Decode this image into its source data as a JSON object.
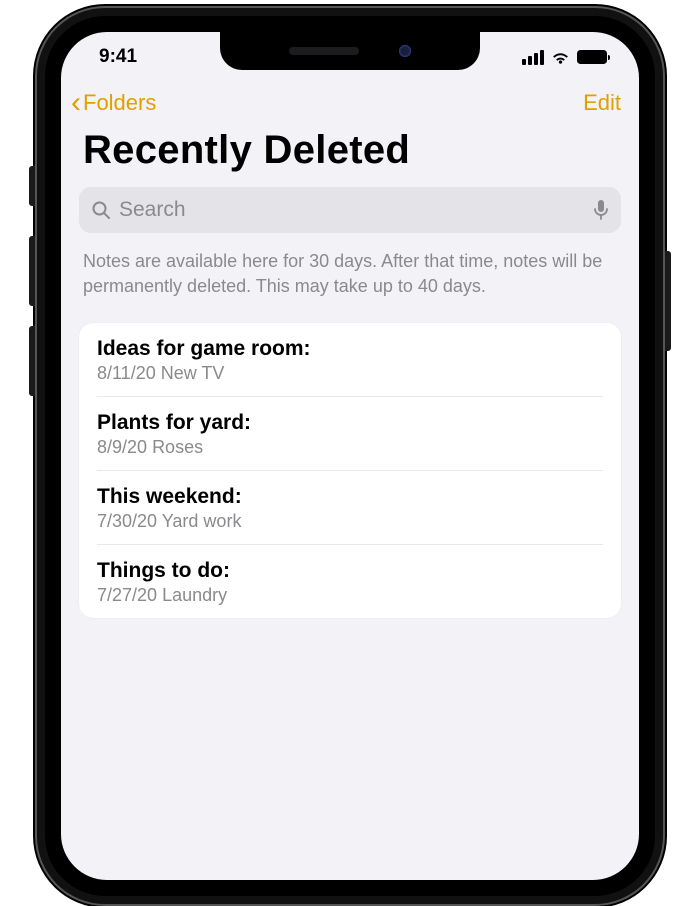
{
  "status": {
    "time": "9:41"
  },
  "nav": {
    "back": "Folders",
    "edit": "Edit"
  },
  "page": {
    "title": "Recently Deleted",
    "search_placeholder": "Search",
    "info": "Notes are available here for 30 days. After that time, notes will be permanently deleted. This may take up to 40 days."
  },
  "notes": [
    {
      "title": "Ideas for game room:",
      "date": "8/11/20",
      "preview": "New TV"
    },
    {
      "title": "Plants for yard:",
      "date": "8/9/20",
      "preview": "Roses"
    },
    {
      "title": "This weekend:",
      "date": "7/30/20",
      "preview": "Yard work"
    },
    {
      "title": "Things to do:",
      "date": "7/27/20",
      "preview": "Laundry"
    }
  ]
}
